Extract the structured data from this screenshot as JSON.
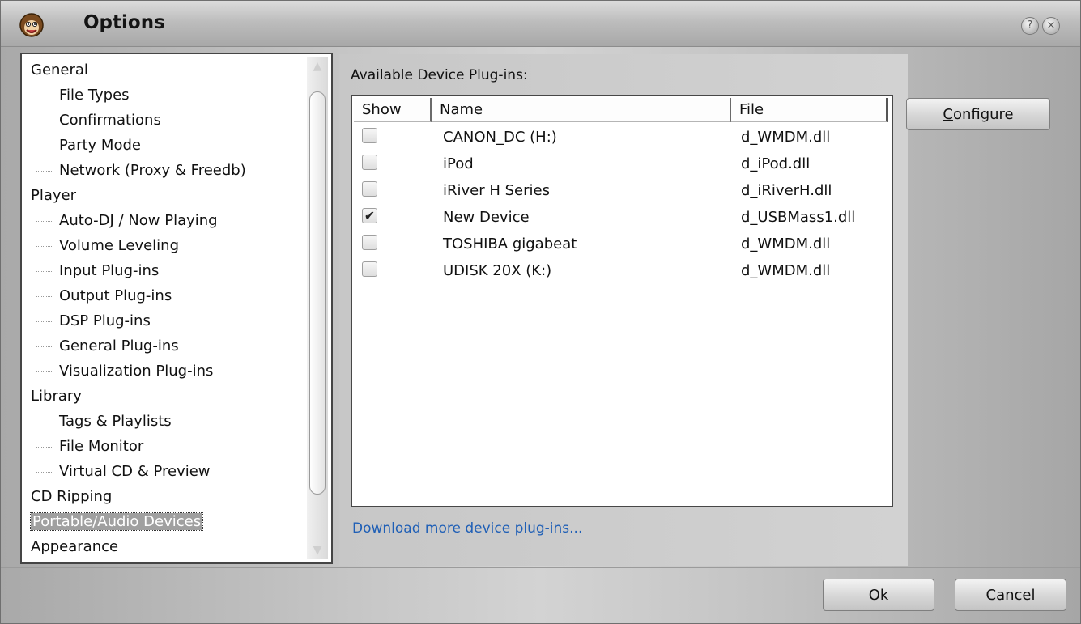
{
  "window": {
    "title": "Options"
  },
  "tree": [
    {
      "label": "General",
      "level": 0
    },
    {
      "label": "File Types",
      "level": 1
    },
    {
      "label": "Confirmations",
      "level": 1
    },
    {
      "label": "Party Mode",
      "level": 1
    },
    {
      "label": "Network (Proxy & Freedb)",
      "level": 1,
      "last": true
    },
    {
      "label": "Player",
      "level": 0
    },
    {
      "label": "Auto-DJ / Now Playing",
      "level": 1
    },
    {
      "label": "Volume Leveling",
      "level": 1
    },
    {
      "label": "Input Plug-ins",
      "level": 1
    },
    {
      "label": "Output Plug-ins",
      "level": 1
    },
    {
      "label": "DSP Plug-ins",
      "level": 1
    },
    {
      "label": "General Plug-ins",
      "level": 1
    },
    {
      "label": "Visualization Plug-ins",
      "level": 1,
      "last": true
    },
    {
      "label": "Library",
      "level": 0
    },
    {
      "label": "Tags & Playlists",
      "level": 1
    },
    {
      "label": "File Monitor",
      "level": 1
    },
    {
      "label": "Virtual CD & Preview",
      "level": 1,
      "last": true
    },
    {
      "label": "CD Ripping",
      "level": 0
    },
    {
      "label": "Portable/Audio Devices",
      "level": 0,
      "selected": true
    },
    {
      "label": "Appearance",
      "level": 0
    }
  ],
  "plugins": {
    "section_label": "Available Device Plug-ins:",
    "columns": {
      "show": "Show",
      "name": "Name",
      "file": "File"
    },
    "rows": [
      {
        "name": "CANON_DC (H:)",
        "file": "d_WMDM.dll",
        "checked": false
      },
      {
        "name": "iPod",
        "file": "d_iPod.dll",
        "checked": false
      },
      {
        "name": "iRiver H Series",
        "file": "d_iRiverH.dll",
        "checked": false
      },
      {
        "name": "New Device",
        "file": "d_USBMass1.dll",
        "checked": true
      },
      {
        "name": "TOSHIBA gigabeat",
        "file": "d_WMDM.dll",
        "checked": false
      },
      {
        "name": "UDISK 20X (K:)",
        "file": "d_WMDM.dll",
        "checked": false
      }
    ],
    "download_link": "Download more device plug-ins..."
  },
  "buttons": {
    "configure": {
      "key": "C",
      "rest": "onfigure"
    },
    "ok": {
      "key": "O",
      "rest": "k"
    },
    "cancel": {
      "key": "C",
      "rest": "ancel"
    }
  },
  "icons": {
    "app": "monkey-face-icon",
    "help": "help-icon",
    "close": "close-icon",
    "check": "✔"
  }
}
